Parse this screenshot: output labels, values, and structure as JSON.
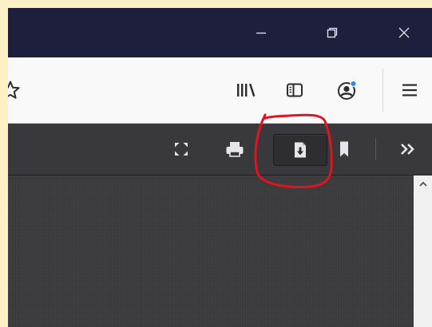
{
  "window": {
    "controls": {
      "minimize_icon": "minimize-icon",
      "restore_icon": "restore-icon",
      "close_icon": "close-icon"
    }
  },
  "nav_toolbar": {
    "bookmark_star_icon": "star-icon",
    "library_icon": "library-icon",
    "sidebar_icon": "sidebar-icon",
    "account_icon": "account-icon",
    "menu_icon": "hamburger-menu-icon"
  },
  "pdf_toolbar": {
    "presentation_icon": "presentation-mode-icon",
    "print_icon": "print-icon",
    "download_icon": "download-icon",
    "bookmark_icon": "bookmark-icon",
    "tools_icon": "double-chevron-icon"
  },
  "colors": {
    "titlebar": "#1e1f3d",
    "nav_bg": "#f9f9fa",
    "pdf_toolbar_bg": "#38383d",
    "viewer_bg": "#3a3a3c",
    "annotation": "#e0151b",
    "account_badge": "#2b8cf0",
    "page_border": "#fdefc6"
  }
}
